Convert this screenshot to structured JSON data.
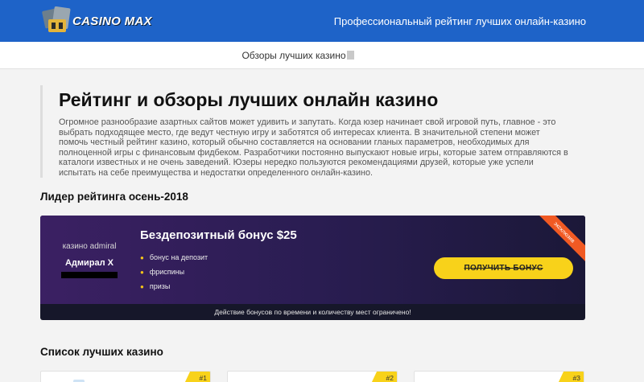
{
  "header": {
    "logo_text": "CASINO MAX",
    "tagline": "Профессиональный рейтинг лучших онлайн-казино"
  },
  "subnav": {
    "link": "Обзоры лучших казино"
  },
  "intro": {
    "title": "Рейтинг и обзоры лучших онлайн казино",
    "text": "Огромное разнообразие азартных сайтов может удивить и запутать. Когда юзер начинает свой игровой путь, главное - это выбрать подходящее место, где ведут честную игру и заботятся об интересах клиента. В значительной степени может помочь честный рейтинг казино, который обычно составляется на основании гланых параметров, необходимых для полноценной игры с финансовым фидбеком. Разработчики постоянно выпускают новые игры, которые затем отправляются в каталоги известных и не очень заведений. Юзеры нередко пользуются рекомендациями друзей, которые уже успели испытать на себе преимущества и недостатки определенного онлайн-казино."
  },
  "leader": {
    "section_title": "Лидер рейтинга осень-2018",
    "side_note": "казино admiral",
    "casino_name": "Адмирал Х",
    "bonus_title": "Бездепозитный бонус $25",
    "features": [
      "бонус на депозит",
      "фриспины",
      "призы"
    ],
    "cta_label": "ПОЛУЧИТЬ БОНУС",
    "ribbon_label": "эксклюзив",
    "footer_note": "Действие бонусов по времени и количеству мест ограничено!",
    "colors": {
      "accent": "#f8d21a",
      "ribbon": "#f15a23",
      "header": "#1e63c8"
    }
  },
  "list": {
    "section_title": "Список лучших казино",
    "cards": [
      {
        "rank": "#1"
      },
      {
        "rank": "#2"
      },
      {
        "rank": "#3"
      }
    ]
  }
}
